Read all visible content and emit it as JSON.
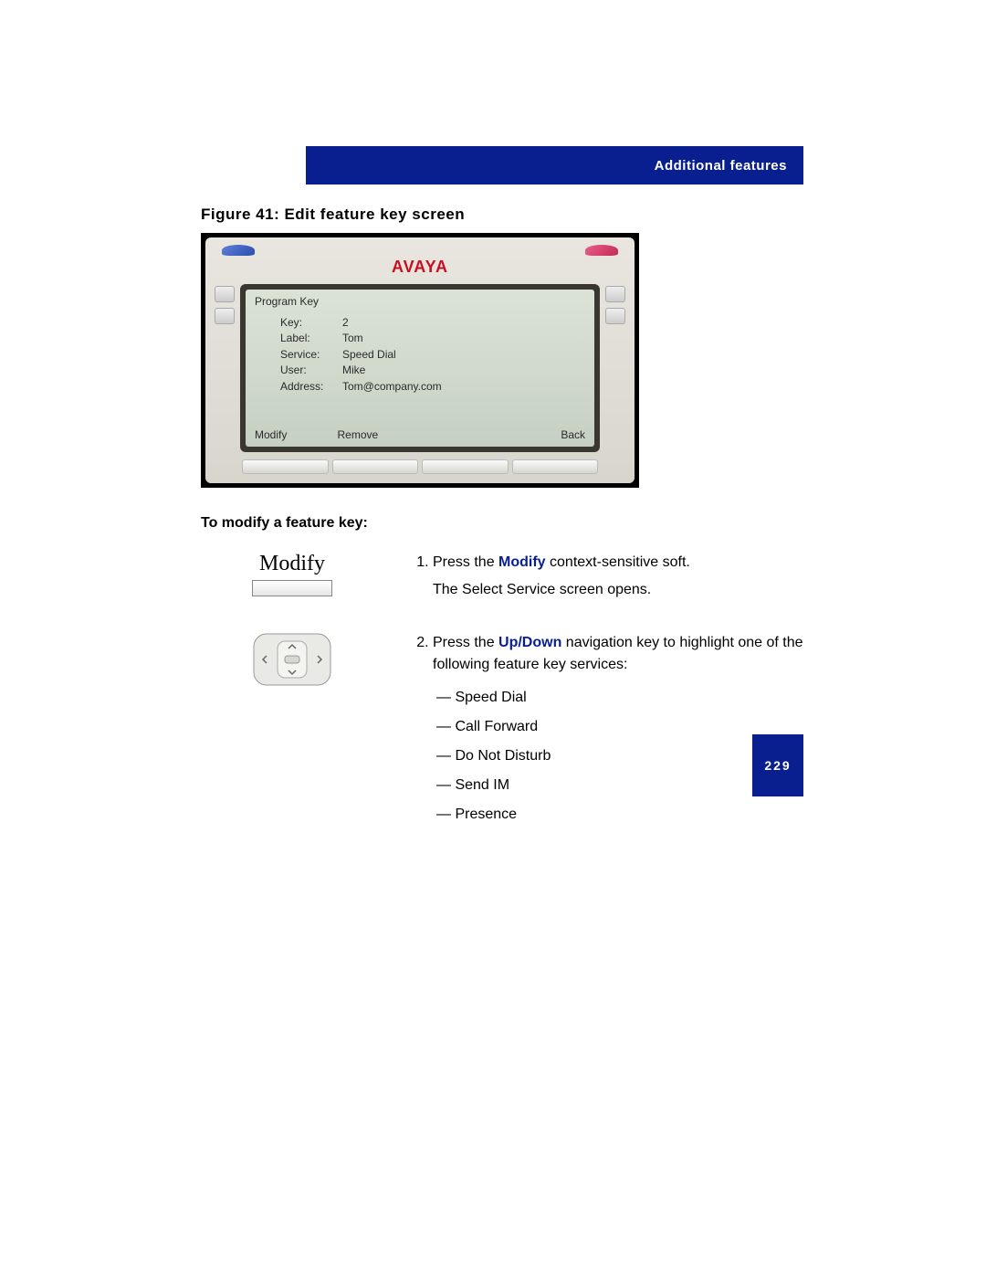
{
  "header": {
    "section_title": "Additional features"
  },
  "figure": {
    "caption": "Figure 41: Edit feature key screen",
    "logo": "AVAYA",
    "screen": {
      "title": "Program Key",
      "fields": [
        {
          "label": "Key:",
          "value": "2"
        },
        {
          "label": "Label:",
          "value": "Tom"
        },
        {
          "label": "Service:",
          "value": "Speed Dial"
        },
        {
          "label": "User:",
          "value": "Mike"
        },
        {
          "label": "Address:",
          "value": "Tom@company.com"
        }
      ],
      "softkeys": {
        "left1": "Modify",
        "left2": "Remove",
        "right": "Back"
      }
    }
  },
  "body": {
    "sub_heading": "To modify a feature key:",
    "modify_label": "Modify",
    "step1": {
      "prefix": "Press the ",
      "bold": "Modify",
      "suffix": " context-sensitive soft.",
      "line2": "The Select Service screen opens."
    },
    "step2": {
      "prefix": "Press the ",
      "bold": "Up/Down",
      "suffix": " navigation key to highlight one of the following feature key services:"
    },
    "services": [
      "Speed Dial",
      "Call Forward",
      "Do Not Disturb",
      "Send IM",
      "Presence"
    ]
  },
  "page_number": "229"
}
